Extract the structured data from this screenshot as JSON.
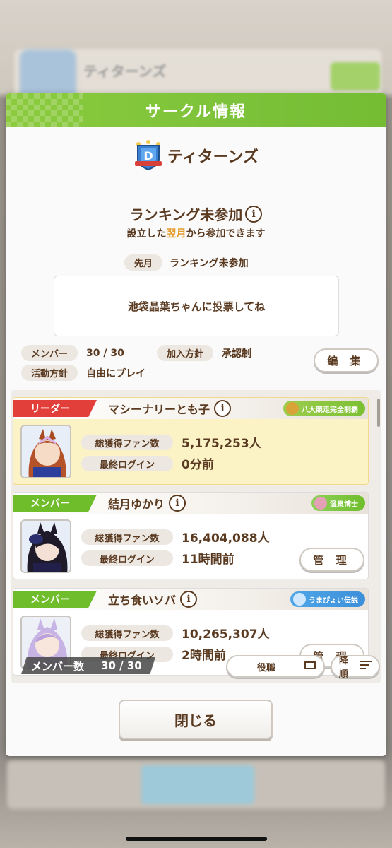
{
  "modal": {
    "title": "サークル情報",
    "circle_name": "ティターンズ",
    "emblem_letter": "D",
    "ranking_title": "ランキング未参加",
    "ranking_note_pre": "設立した",
    "ranking_note_hl": "翌月",
    "ranking_note_post": "から参加できます",
    "last_month_label": "先月",
    "last_month_value": "ランキング未参加",
    "message": "池袋晶葉ちゃんに投票してね",
    "members_label": "メンバー",
    "members_value": "30 / 30",
    "join_policy_label": "加入方針",
    "join_policy_value": "承認制",
    "activity_label": "活動方針",
    "activity_value": "自由にプレイ",
    "edit_label": "編 集",
    "close_label": "閉じる"
  },
  "list": {
    "fans_label": "総獲得ファン数",
    "login_label": "最終ログイン",
    "manage_label": "管 理",
    "members": [
      {
        "role": "リーダー",
        "name": "マシーナリーとも子",
        "badge": "八大競走完全制覇",
        "fans": "5,175,253人",
        "login": "0分前"
      },
      {
        "role": "メンバー",
        "name": "結月ゆかり",
        "badge": "温泉博士",
        "fans": "16,404,088人",
        "login": "11時間前"
      },
      {
        "role": "メンバー",
        "name": "立ち食いソバ",
        "badge": "うまぴょい伝説",
        "fans": "10,265,307人",
        "login": "2時間前"
      }
    ],
    "member_count_label": "メンバー数",
    "member_count_value": "30 / 30",
    "sort_role_label": "役職",
    "sort_order_label": "降順"
  },
  "colors": {
    "header_green": "#7cc23a",
    "leader_red": "#e33f3a",
    "member_green": "#6fbd2b",
    "text_brown": "#5a3a20",
    "accent_orange": "#e39b2a"
  }
}
